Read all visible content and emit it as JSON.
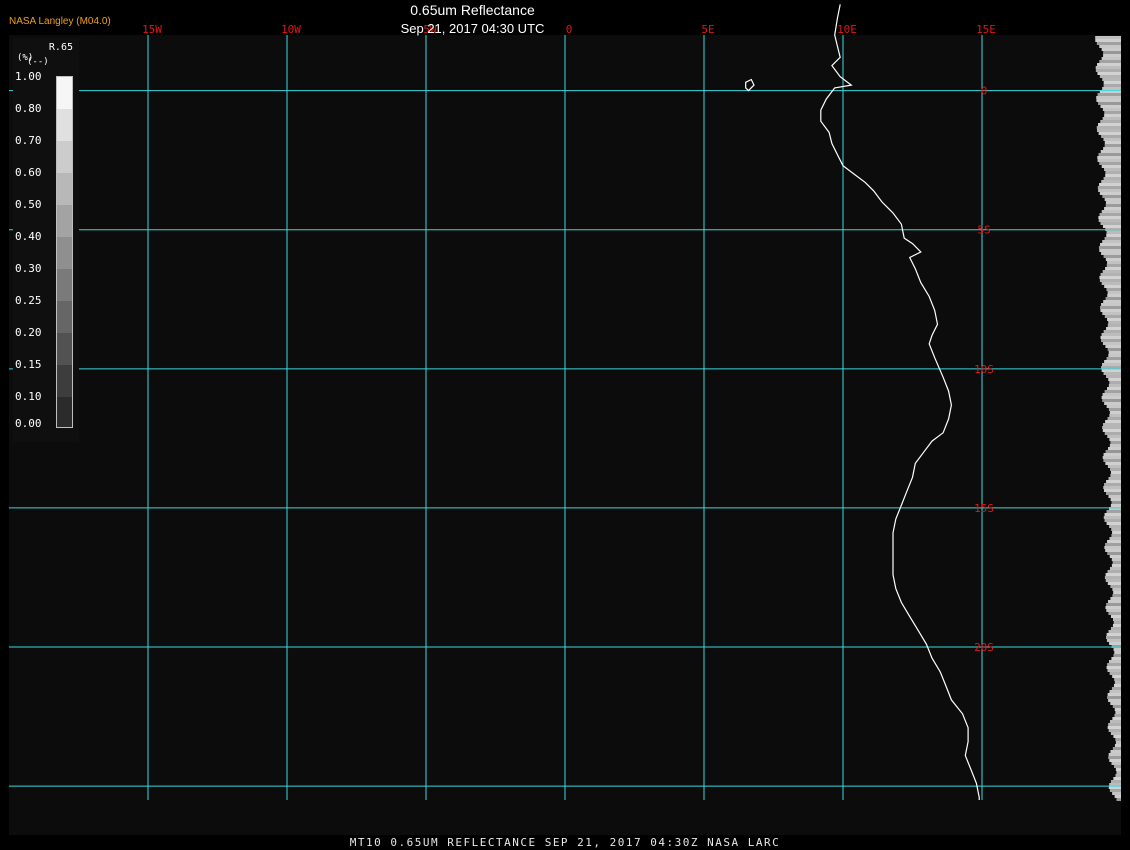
{
  "header": {
    "agency": "NASA Langley (M04.0)",
    "title": "0.65um Reflectance",
    "datetime": "Sep 21, 2017 04:30 UTC"
  },
  "footer": {
    "caption": "MT10  0.65UM REFLECTANCE   SEP 21, 2017 04:30Z   NASA LARC"
  },
  "colorbar": {
    "variable": "R.65",
    "units_label": "(%)",
    "units_sub": "(--)",
    "ticks": [
      "1.00",
      "0.80",
      "0.70",
      "0.60",
      "0.50",
      "0.40",
      "0.30",
      "0.25",
      "0.20",
      "0.15",
      "0.10",
      "0.00"
    ],
    "swatch_colors": [
      "#f6f6f6",
      "#e0e0e0",
      "#cccccc",
      "#b8b8b8",
      "#a3a3a3",
      "#8f8f8f",
      "#7a7a7a",
      "#666666",
      "#525252",
      "#3d3d3d",
      "#2b2b2b"
    ]
  },
  "map": {
    "longitude_labels": [
      "15W",
      "10W",
      "5W",
      "0",
      "5E",
      "10E",
      "15E"
    ],
    "latitude_labels": [
      "0",
      "5S",
      "10S",
      "15S",
      "20S"
    ],
    "longitudes_deg": [
      -15,
      -10,
      -5,
      0,
      5,
      10,
      15
    ],
    "latitudes_deg": [
      0,
      -5,
      -10,
      -15,
      -20,
      -25
    ],
    "lon_range": [
      -20,
      20
    ],
    "lat_range": [
      2,
      -25.5
    ],
    "coastline_lonlat": [
      [
        9.9,
        3.1
      ],
      [
        9.8,
        2.6
      ],
      [
        9.7,
        2.0
      ],
      [
        9.8,
        1.6
      ],
      [
        9.9,
        1.2
      ],
      [
        9.6,
        0.9
      ],
      [
        9.9,
        0.5
      ],
      [
        10.3,
        0.2
      ],
      [
        9.7,
        0.1
      ],
      [
        9.4,
        -0.3
      ],
      [
        9.2,
        -0.7
      ],
      [
        9.2,
        -1.1
      ],
      [
        9.5,
        -1.5
      ],
      [
        9.6,
        -1.9
      ],
      [
        9.8,
        -2.3
      ],
      [
        10.0,
        -2.7
      ],
      [
        10.4,
        -3.0
      ],
      [
        10.8,
        -3.3
      ],
      [
        11.1,
        -3.6
      ],
      [
        11.4,
        -4.0
      ],
      [
        11.8,
        -4.4
      ],
      [
        12.1,
        -4.8
      ],
      [
        12.2,
        -5.3
      ],
      [
        12.5,
        -5.5
      ],
      [
        12.8,
        -5.8
      ],
      [
        12.4,
        -6.0
      ],
      [
        12.6,
        -6.4
      ],
      [
        12.8,
        -6.9
      ],
      [
        13.1,
        -7.4
      ],
      [
        13.3,
        -7.9
      ],
      [
        13.4,
        -8.4
      ],
      [
        13.2,
        -8.8
      ],
      [
        13.1,
        -9.1
      ],
      [
        13.3,
        -9.6
      ],
      [
        13.6,
        -10.3
      ],
      [
        13.8,
        -10.8
      ],
      [
        13.9,
        -11.3
      ],
      [
        13.8,
        -11.8
      ],
      [
        13.6,
        -12.3
      ],
      [
        13.2,
        -12.6
      ],
      [
        12.9,
        -13.0
      ],
      [
        12.6,
        -13.4
      ],
      [
        12.5,
        -13.9
      ],
      [
        12.3,
        -14.4
      ],
      [
        12.1,
        -14.9
      ],
      [
        11.9,
        -15.4
      ],
      [
        11.8,
        -15.9
      ],
      [
        11.8,
        -16.4
      ],
      [
        11.8,
        -16.9
      ],
      [
        11.8,
        -17.4
      ],
      [
        11.9,
        -17.9
      ],
      [
        12.1,
        -18.4
      ],
      [
        12.4,
        -18.9
      ],
      [
        12.7,
        -19.4
      ],
      [
        13.0,
        -19.9
      ],
      [
        13.2,
        -20.4
      ],
      [
        13.5,
        -20.9
      ],
      [
        13.7,
        -21.4
      ],
      [
        13.9,
        -21.9
      ],
      [
        14.3,
        -22.4
      ],
      [
        14.5,
        -22.9
      ],
      [
        14.5,
        -23.4
      ],
      [
        14.4,
        -23.9
      ],
      [
        14.6,
        -24.4
      ],
      [
        14.8,
        -24.9
      ],
      [
        14.9,
        -25.4
      ],
      [
        14.9,
        -25.5
      ]
    ],
    "island_lonlat": [
      [
        6.5,
        0.3
      ],
      [
        6.7,
        0.4
      ],
      [
        6.8,
        0.2
      ],
      [
        6.6,
        0.0
      ],
      [
        6.5,
        0.1
      ],
      [
        6.5,
        0.3
      ]
    ]
  },
  "colors": {
    "background": "#0c0c0c",
    "grid": "#3ad7df",
    "grid_label": "#e01818",
    "coastline": "#ffffff",
    "agency_text": "#f0a018",
    "text": "#ffffff",
    "footer_text": "#e8e8e8",
    "colorbar_panel": "#0f0f0f"
  }
}
